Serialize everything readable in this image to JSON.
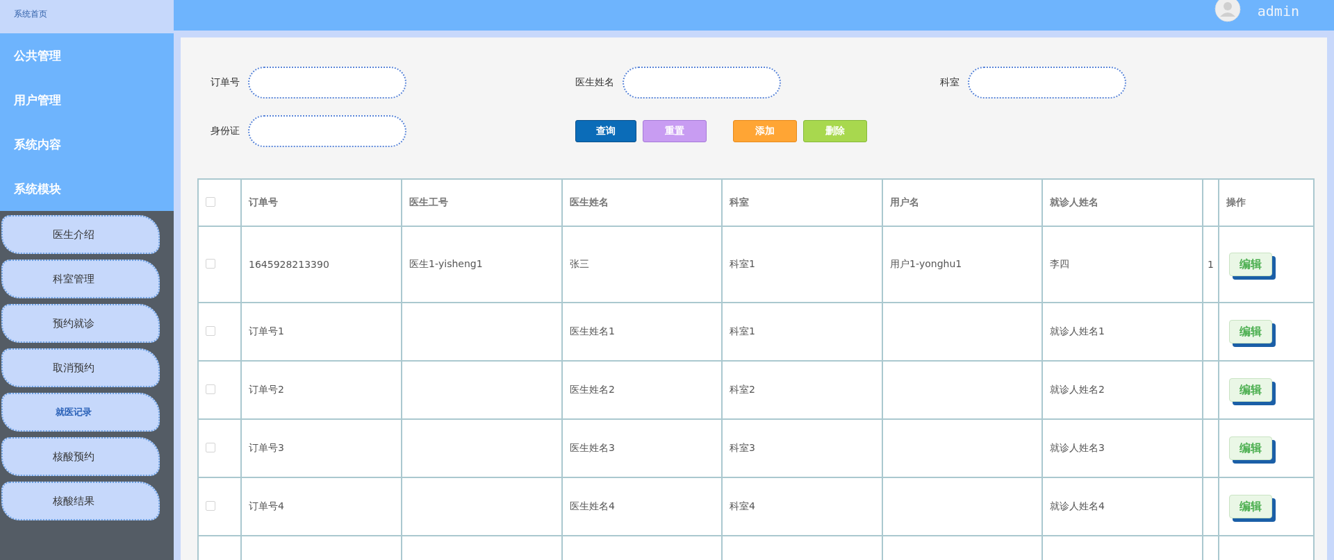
{
  "sidebar": {
    "home": "系统首页",
    "groups": [
      {
        "label": "公共管理"
      },
      {
        "label": "用户管理"
      },
      {
        "label": "系统内容"
      },
      {
        "label": "系统模块"
      }
    ],
    "items": [
      {
        "label": "医生介绍",
        "active": false
      },
      {
        "label": "科室管理",
        "active": false
      },
      {
        "label": "预约就诊",
        "active": false
      },
      {
        "label": "取消预约",
        "active": false
      },
      {
        "label": "就医记录",
        "active": true
      },
      {
        "label": "核酸预约",
        "active": false
      },
      {
        "label": "核酸结果",
        "active": false
      }
    ]
  },
  "header": {
    "user": "admin"
  },
  "search": {
    "fields": [
      {
        "label": "订单号"
      },
      {
        "label": "医生姓名"
      },
      {
        "label": "科室"
      },
      {
        "label": "身份证"
      }
    ],
    "buttons": [
      {
        "label": "查询",
        "kind": "query"
      },
      {
        "label": "重置",
        "kind": "reset"
      },
      {
        "label": "添加",
        "kind": "add"
      },
      {
        "label": "删除",
        "kind": "delete"
      }
    ]
  },
  "table": {
    "all_checked": false,
    "columns": [
      "订单号",
      "医生工号",
      "医生姓名",
      "科室",
      "用户名",
      "就诊人姓名"
    ],
    "action_column": "操作",
    "rows": [
      {
        "checked": false,
        "cells": [
          "1645928213390",
          "医生1-yisheng1",
          "张三",
          "科室1",
          "用户1-yonghu1",
          "李四"
        ],
        "column_8": "1",
        "action": "编辑"
      },
      {
        "checked": false,
        "cells": [
          "订单号1",
          "",
          "医生姓名1",
          "科室1",
          "",
          "就诊人姓名1"
        ],
        "action": "编辑"
      },
      {
        "checked": false,
        "cells": [
          "订单号2",
          "",
          "医生姓名2",
          "科室2",
          "",
          "就诊人姓名2"
        ],
        "action": "编辑"
      },
      {
        "checked": false,
        "cells": [
          "订单号3",
          "",
          "医生姓名3",
          "科室3",
          "",
          "就诊人姓名3"
        ],
        "action": "编辑"
      },
      {
        "checked": false,
        "cells": [
          "订单号4",
          "",
          "医生姓名4",
          "科室4",
          "",
          "就诊人姓名4"
        ],
        "action": "编辑"
      }
    ]
  }
}
